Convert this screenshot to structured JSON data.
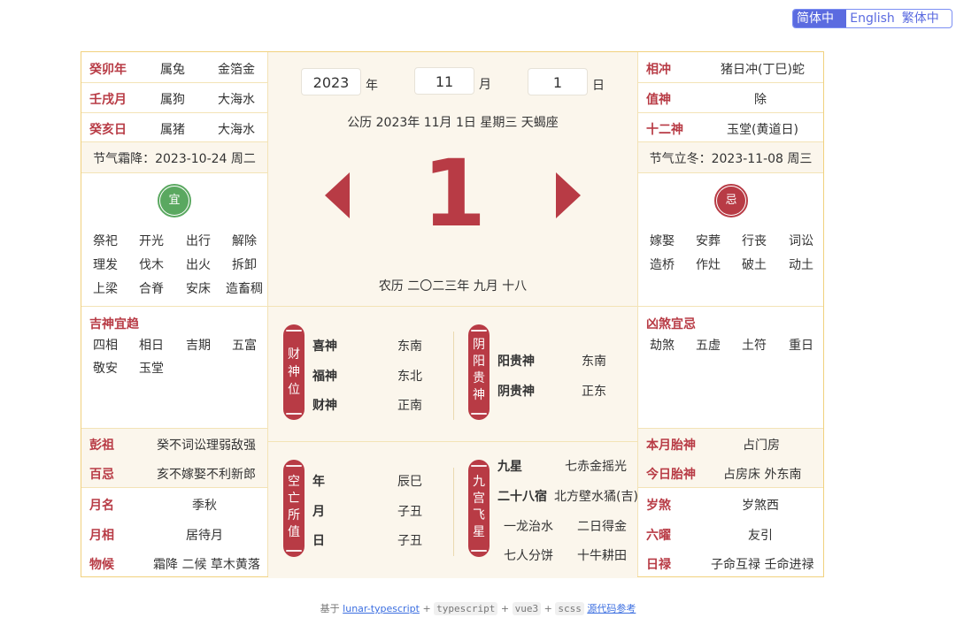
{
  "lang": {
    "items": [
      "简体中文",
      "English",
      "繁体中文"
    ],
    "active": 0
  },
  "left": {
    "ganzhi": [
      {
        "gz": "癸卯年",
        "shu": "属兔",
        "nayin": "金箔金"
      },
      {
        "gz": "壬戌月",
        "shu": "属狗",
        "nayin": "大海水"
      },
      {
        "gz": "癸亥日",
        "shu": "属猪",
        "nayin": "大海水"
      }
    ],
    "jieqi_prev": "节气霜降：2023-10-24 周二",
    "yi_badge": "宜",
    "yi": [
      "祭祀",
      "开光",
      "出行",
      "解除",
      "理发",
      "伐木",
      "出火",
      "拆卸",
      "上梁",
      "合脊",
      "安床",
      "造畜稠"
    ],
    "jishen_title": "吉神宜趋",
    "jishen": [
      "四相",
      "相日",
      "吉期",
      "五富",
      "敬安",
      "玉堂"
    ],
    "pengzu_label": "彭祖",
    "pengzu_value": "癸不词讼理弱敌强",
    "baiji_label": "百忌",
    "baiji_value": "亥不嫁娶不利新郎",
    "yueming_label": "月名",
    "yueming_value": "季秋",
    "yuexiang_label": "月相",
    "yuexiang_value": "居待月",
    "wuhou_label": "物候",
    "wuhou_value": "霜降 二候 草木黄落"
  },
  "center": {
    "year": "2023",
    "year_unit": "年",
    "month": "11",
    "month_unit": "月",
    "day": "1",
    "day_unit": "日",
    "solar": "公历 2023年 11月 1日 星期三 天蝎座",
    "big_day": "1",
    "lunar": "农历 二〇二三年 九月 十八",
    "caishen_pill": "财神位",
    "caishen": [
      {
        "name": "喜神",
        "dir": "东南"
      },
      {
        "name": "福神",
        "dir": "东北"
      },
      {
        "name": "财神",
        "dir": "正南"
      }
    ],
    "guiren_pill": "阴阳贵神",
    "guiren": [
      {
        "name": "阳贵神",
        "dir": "东南"
      },
      {
        "name": "阴贵神",
        "dir": "正东"
      }
    ],
    "kongwang_pill": "空亡所值",
    "kongwang": [
      {
        "name": "年",
        "val": "辰巳"
      },
      {
        "name": "月",
        "val": "子丑"
      },
      {
        "name": "日",
        "val": "子丑"
      }
    ],
    "jiugong_pill": "九宫飞星",
    "jiuxing_label": "九星",
    "jiuxing_value": "七赤金摇光",
    "xiu_label": "二十八宿",
    "xiu_value": "北方壁水獝(吉)",
    "extra": [
      "一龙治水",
      "二日得金",
      "七人分饼",
      "十牛耕田"
    ]
  },
  "right": {
    "chong_label": "相冲",
    "chong_value": "猪日冲(丁巳)蛇",
    "zhishen_label": "值神",
    "zhishen_value": "除",
    "shiershen_label": "十二神",
    "shiershen_value": "玉堂(黄道日)",
    "jieqi_next": "节气立冬：2023-11-08 周三",
    "ji_badge": "忌",
    "ji": [
      "嫁娶",
      "安葬",
      "行丧",
      "词讼",
      "造桥",
      "作灶",
      "破土",
      "动土"
    ],
    "xiongsha_title": "凶煞宜忌",
    "xiongsha": [
      "劫煞",
      "五虚",
      "土符",
      "重日"
    ],
    "yuetai_label": "本月胎神",
    "yuetai_value": "占门房",
    "ritai_label": "今日胎神",
    "ritai_value": "占房床 外东南",
    "suisha_label": "岁煞",
    "suisha_value": "岁煞西",
    "liuyao_label": "六曜",
    "liuyao_value": "友引",
    "rilu_label": "日禄",
    "rilu_value": "子命互禄 壬命进禄"
  },
  "footer": {
    "prefix": "基于",
    "link1": "lunar-typescript",
    "plus": "+",
    "code1": "typescript",
    "code2": "vue3",
    "code3": "scss",
    "link2": "源代码参考"
  },
  "colors": {
    "accent": "#b83b45",
    "green": "#5aa860",
    "border": "#f1d17e",
    "cream": "#fbf6ec",
    "lang": "#5b6be0"
  }
}
